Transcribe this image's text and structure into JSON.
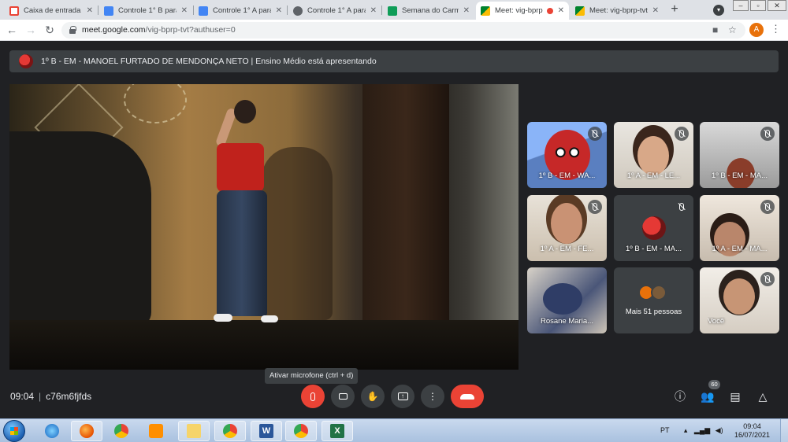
{
  "browser": {
    "tabs": [
      {
        "title": "Caixa de entrada (",
        "icon": "gmail-icon",
        "color": "#ea4335"
      },
      {
        "title": "Controle 1° B para",
        "icon": "docs-icon",
        "color": "#4285f4"
      },
      {
        "title": "Controle 1° A para",
        "icon": "docs-icon",
        "color": "#4285f4"
      },
      {
        "title": "Controle 1° A para",
        "icon": "globe-icon",
        "color": "#5f6368"
      },
      {
        "title": "Semana do Carmo",
        "icon": "classroom-icon",
        "color": "#0f9d58"
      },
      {
        "title": "Meet: vig-bprp",
        "icon": "meet-icon",
        "color": "#00897b",
        "active": true
      },
      {
        "title": "Meet: vig-bprp-tvt",
        "icon": "meet-icon",
        "color": "#00897b"
      }
    ],
    "new_tab": "+",
    "url_host": "meet.google.com",
    "url_path": "/vig-bprp-tvt?authuser=0",
    "profile_initial": "A"
  },
  "meet": {
    "presenting_banner": "1º B - EM - MANOEL FURTADO DE MENDONÇA NETO | Ensino Médio está apresentando",
    "participants": [
      {
        "name": "1º B - EM - WA..."
      },
      {
        "name": "1º A - EM - LE..."
      },
      {
        "name": "1º B - EM - MA..."
      },
      {
        "name": "1º A - EM - FE..."
      },
      {
        "name": "1º B - EM - MA..."
      },
      {
        "name": "1º A - EM - MA..."
      },
      {
        "name": "Rosane Maria..."
      },
      {
        "name": "Mais 51 pessoas"
      },
      {
        "name": "Você"
      }
    ],
    "tooltip": "Ativar microfone (ctrl + d)",
    "time": "09:04",
    "separator": "|",
    "meeting_code": "c76m6fjfds",
    "participant_count": "60"
  },
  "taskbar": {
    "lang": "PT",
    "clock_time": "09:04",
    "clock_date": "16/07/2021"
  }
}
